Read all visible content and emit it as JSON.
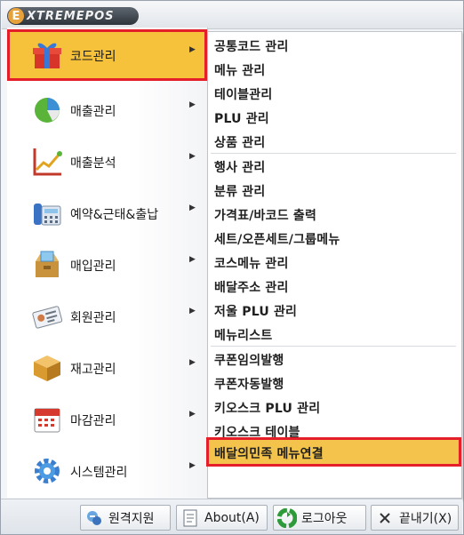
{
  "app": {
    "logo_text": "XTREMEPOS",
    "logo_letter": "E"
  },
  "left_menu": {
    "items": [
      {
        "label": "코드관리",
        "icon": "gift-icon",
        "selected": true
      },
      {
        "label": "매출관리",
        "icon": "pie-chart-icon"
      },
      {
        "label": "매출분석",
        "icon": "line-chart-icon"
      },
      {
        "label": "예약&근태&출납",
        "icon": "phone-icon"
      },
      {
        "label": "매입관리",
        "icon": "box-icon"
      },
      {
        "label": "회원관리",
        "icon": "id-card-icon"
      },
      {
        "label": "재고관리",
        "icon": "cube-icon"
      },
      {
        "label": "마감관리",
        "icon": "calendar-icon"
      },
      {
        "label": "시스템관리",
        "icon": "gear-icon"
      }
    ]
  },
  "submenu": {
    "items": [
      "공통코드 관리",
      "메뉴 관리",
      "테이블관리",
      "PLU 관리",
      "상품 관리",
      "행사 관리",
      "분류 관리",
      "가격표/바코드 출력",
      "세트/오픈세트/그룹메뉴",
      "코스메뉴 관리",
      "배달주소 관리",
      "저울 PLU 관리",
      "메뉴리스트",
      "쿠폰임의발행",
      "쿠폰자동발행",
      "키오스크 PLU 관리",
      "키오스크 테이블",
      "배달의민족 메뉴연결"
    ],
    "selected_index": 17
  },
  "footer": {
    "remote_support": "원격지원",
    "about": "About(A)",
    "logout": "로그아웃",
    "exit": "끝내기(X)"
  },
  "colors": {
    "highlight": "#f3c34b",
    "selection_border": "#e41f2a"
  }
}
